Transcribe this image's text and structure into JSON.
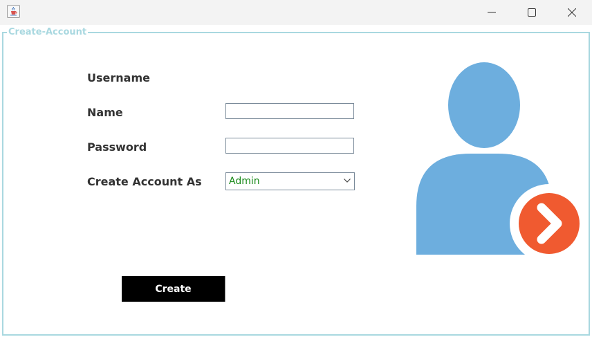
{
  "window": {
    "title": "",
    "app_icon": "java-cup-icon",
    "controls": [
      "minimize-icon",
      "maximize-icon",
      "close-icon"
    ]
  },
  "form": {
    "group_title": "Create-Account",
    "username_label": "Username",
    "name_label": "Name",
    "password_label": "Password",
    "create_as_label": "Create Account As",
    "name_value": "",
    "password_value": "",
    "account_type_value": "Admin",
    "create_button": "Create"
  },
  "illustration": {
    "icon": "user-login-icon",
    "person_color": "#6daede",
    "badge_color": "#f05a30"
  },
  "colors": {
    "group_border": "#a9d8e0",
    "label_text": "#333333",
    "combo_text": "#1a8a1a",
    "button_bg": "#000000",
    "button_text": "#ffffff"
  }
}
